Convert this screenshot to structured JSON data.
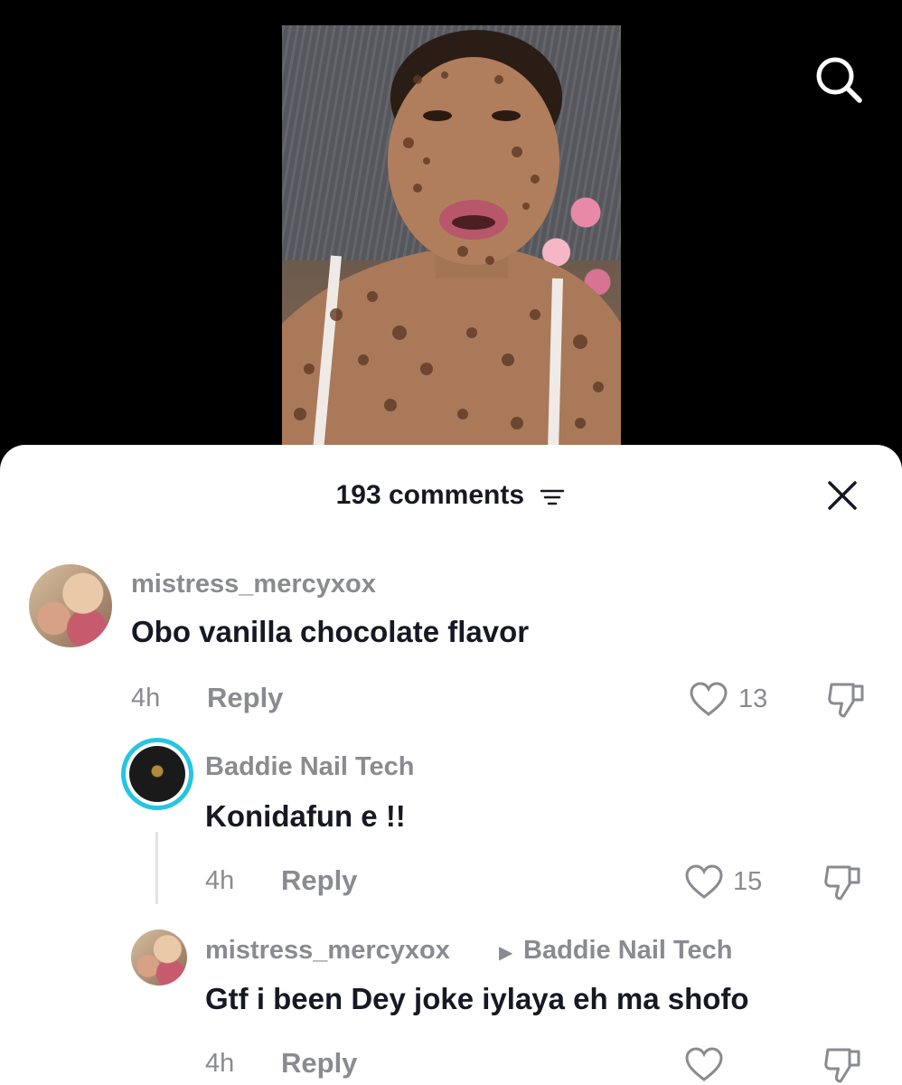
{
  "header": {
    "comment_count_label": "193 comments"
  },
  "comments": [
    {
      "username": "mistress_mercyxox",
      "text": "Obo vanilla chocolate flavor",
      "time": "4h",
      "reply_label": "Reply",
      "likes": "13"
    },
    {
      "username": "Baddie Nail Tech",
      "text": "Konidafun e !!",
      "time": "4h",
      "reply_label": "Reply",
      "likes": "15"
    },
    {
      "username": "mistress_mercyxox",
      "reply_to": "Baddie Nail Tech",
      "text": "Gtf i been Dey joke iylaya eh ma shofo",
      "time": "4h",
      "reply_label": "Reply",
      "likes": ""
    }
  ],
  "icons": {
    "search": "search-icon",
    "filter": "filter-icon",
    "close": "close-icon",
    "like": "heart-icon",
    "dislike": "thumbs-down-icon"
  },
  "colors": {
    "text_primary": "#161823",
    "text_secondary": "#8a8b91",
    "story_ring": "#25c5e0"
  }
}
